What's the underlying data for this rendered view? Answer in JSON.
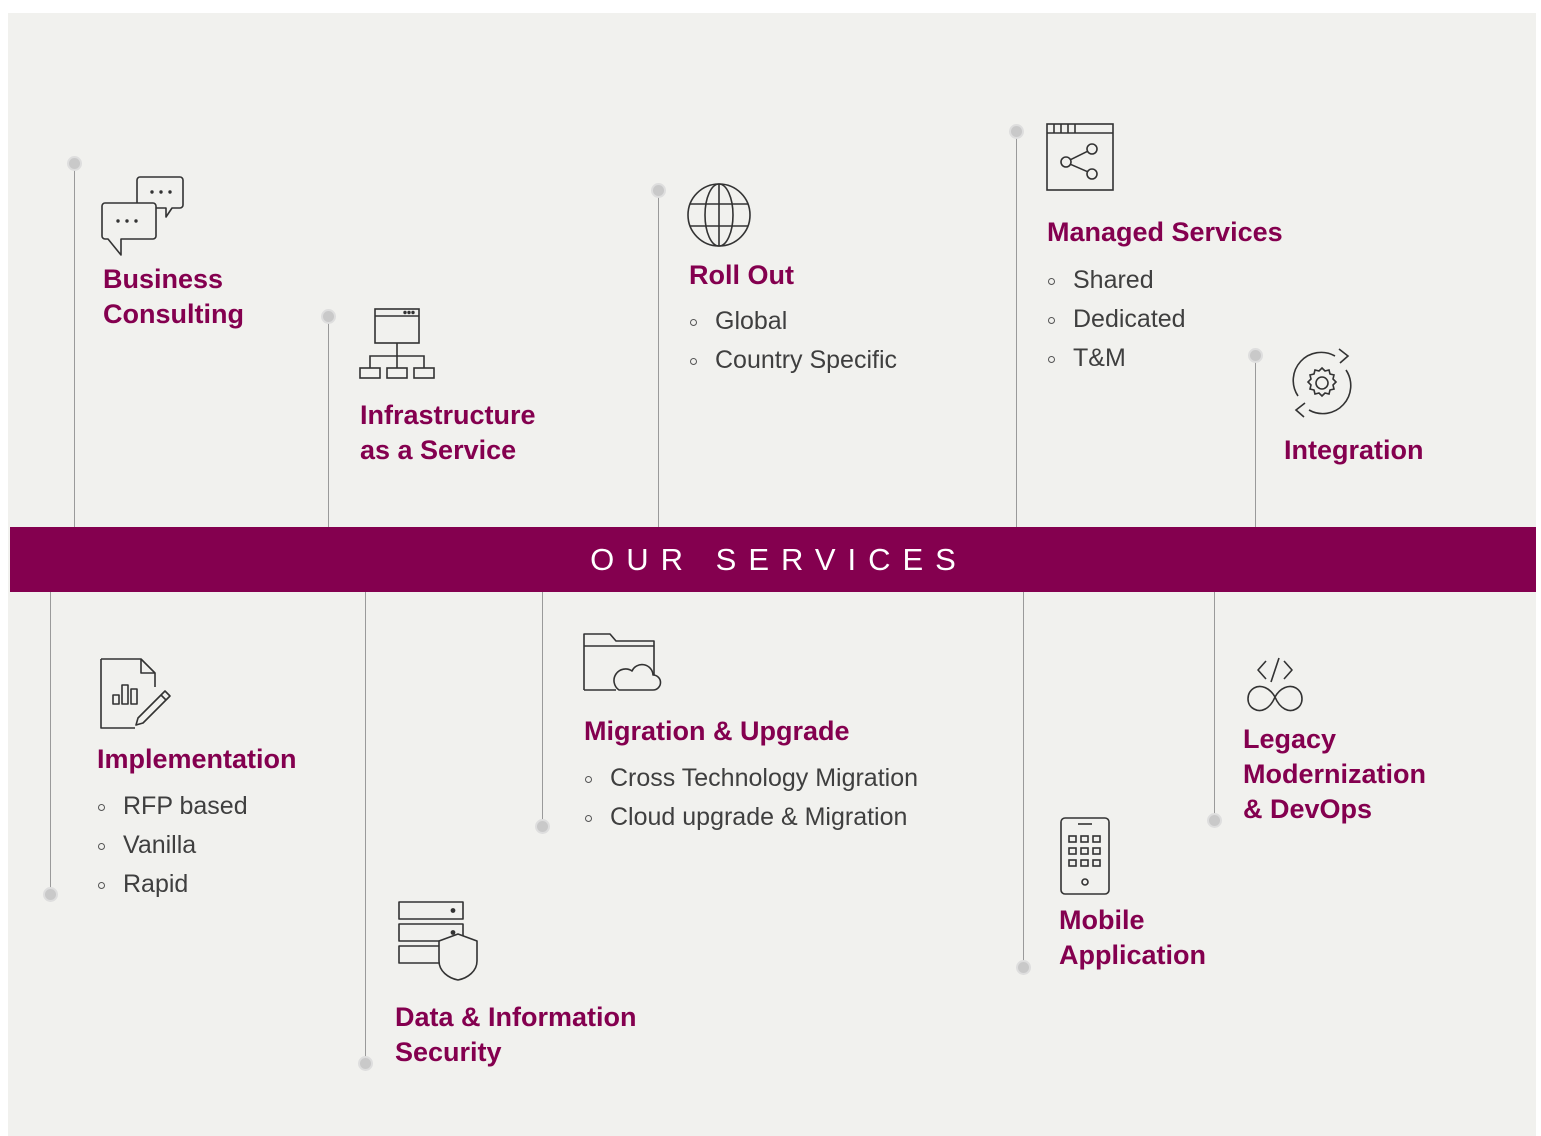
{
  "band_title": "OUR SERVICES",
  "colors": {
    "accent": "#84004f",
    "background": "#f1f1ee",
    "line": "#9a9a9a",
    "text": "#3f3f3f"
  },
  "services": [
    {
      "id": "business-consulting",
      "icon": "chat-bubbles-icon",
      "title": [
        "Business",
        "Consulting"
      ],
      "items": []
    },
    {
      "id": "infrastructure",
      "icon": "network-hierarchy-icon",
      "title": [
        "Infrastructure",
        "as a Service"
      ],
      "items": []
    },
    {
      "id": "roll-out",
      "icon": "globe-icon",
      "title": [
        "Roll Out"
      ],
      "items": [
        "Global",
        "Country Specific"
      ]
    },
    {
      "id": "managed-services",
      "icon": "share-window-icon",
      "title": [
        "Managed Services"
      ],
      "items": [
        "Shared",
        "Dedicated",
        "T&M"
      ]
    },
    {
      "id": "integration",
      "icon": "gear-sync-icon",
      "title": [
        "Integration"
      ],
      "items": []
    },
    {
      "id": "implementation",
      "icon": "report-edit-icon",
      "title": [
        "Implementation"
      ],
      "items": [
        "RFP based",
        "Vanilla",
        "Rapid"
      ]
    },
    {
      "id": "data-security",
      "icon": "server-shield-icon",
      "title": [
        "Data & Information",
        "Security"
      ],
      "items": []
    },
    {
      "id": "migration",
      "icon": "cloud-folder-icon",
      "title": [
        "Migration & Upgrade"
      ],
      "items": [
        "Cross Technology Migration",
        "Cloud upgrade & Migration"
      ]
    },
    {
      "id": "mobile",
      "icon": "mobile-app-icon",
      "title": [
        "Mobile",
        "Application"
      ],
      "items": []
    },
    {
      "id": "legacy",
      "icon": "code-infinity-icon",
      "title": [
        "Legacy",
        "Modernization",
        "& DevOps"
      ],
      "items": []
    }
  ]
}
